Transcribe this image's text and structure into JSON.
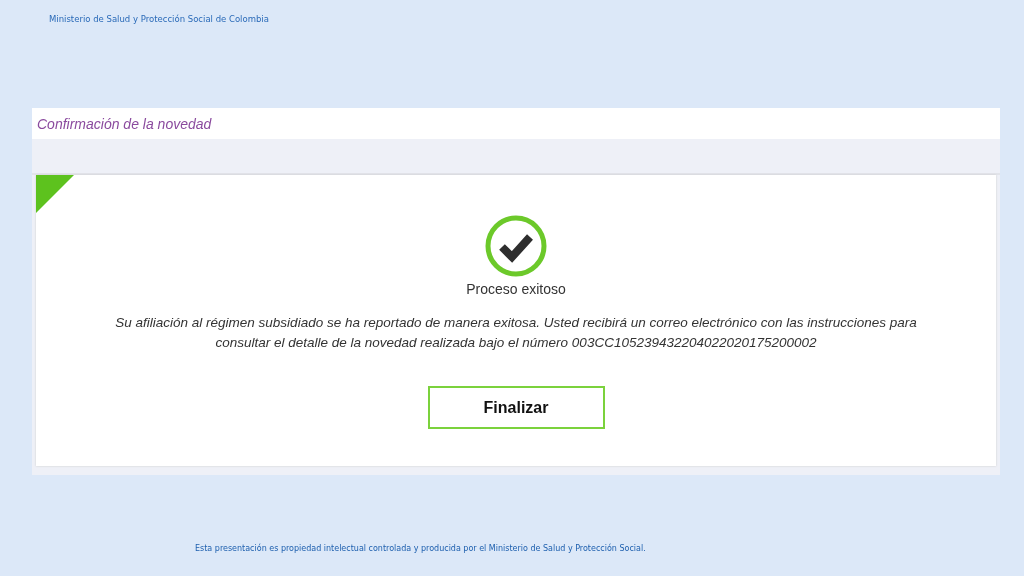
{
  "header": {
    "text": "Ministerio de Salud y Protección Social de Colombia"
  },
  "panel": {
    "title": "Confirmación de la novedad",
    "status": {
      "kind": "success",
      "label": "Proceso exitoso"
    },
    "message_line_1": "Su afiliación al régimen subsidiado se ha reportado de manera exitosa. Usted recibirá un correo electrónico con las instrucciones para",
    "message_line_2": "consultar el detalle de la novedad realizada bajo el número 003CC105239432204022020175200002",
    "button": "Finalizar"
  },
  "footer": {
    "text": "Esta presentación es propiedad intelectual controlada y producida por el Ministerio de Salud y Protección Social."
  }
}
